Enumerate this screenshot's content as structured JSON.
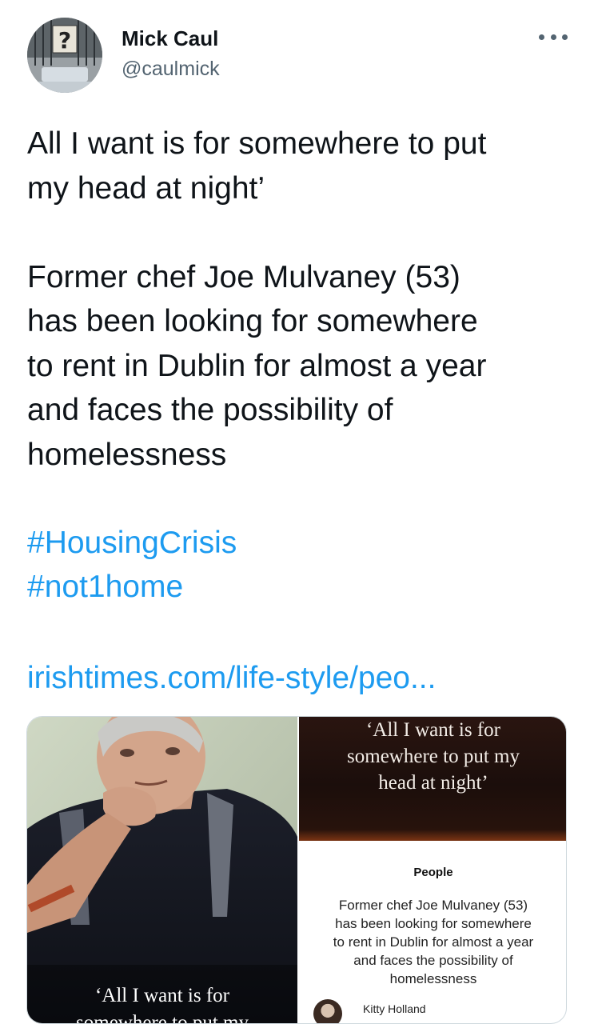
{
  "author": {
    "name": "Mick Caul",
    "handle": "@caulmick"
  },
  "tweet": {
    "text": "All I want is for somewhere to put\nmy head at night’\n\nFormer chef Joe Mulvaney (53)\nhas been looking for somewhere\nto rent in Dublin for almost a year\nand faces the possibility of\nhomelessness",
    "hashtags": [
      "#HousingCrisis",
      "#not1home"
    ],
    "link": "irishtimes.com/life-style/peo..."
  },
  "card": {
    "image_caption": "‘All I want is for\nsomewhere to put my",
    "title": "‘All I want is for\nsomewhere to put my\nhead at night’",
    "section": "People",
    "summary": "Former chef Joe Mulvaney (53)\nhas been looking for somewhere\nto rent in Dublin for almost a year\nand faces the possibility of\nhomelessness",
    "author": "Kitty Holland"
  },
  "colors": {
    "link": "#1d9bf0",
    "text": "#0f1419",
    "secondary": "#536471",
    "border": "#cfd9de"
  }
}
